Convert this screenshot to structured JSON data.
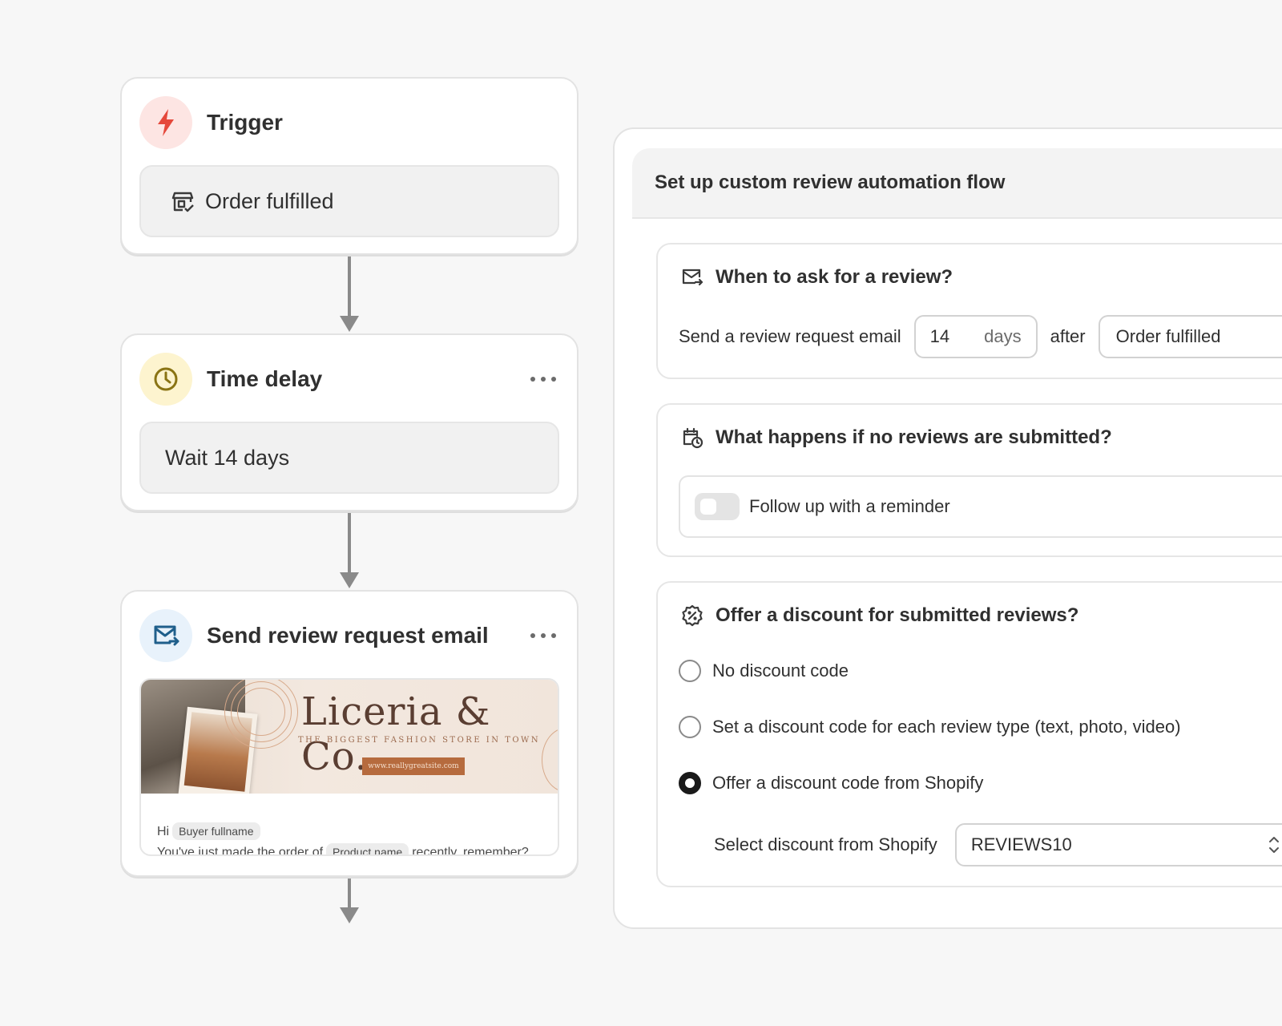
{
  "flow": {
    "trigger": {
      "title": "Trigger",
      "event": "Order fulfilled",
      "icon": "lightning-icon"
    },
    "delay": {
      "title": "Time delay",
      "text": "Wait 14 days",
      "icon": "clock-icon"
    },
    "email": {
      "title": "Send review request email",
      "icon": "mail-forward-icon",
      "brand": "Liceria & Co.",
      "tagline": "THE BIGGEST FASHION STORE IN TOWN",
      "site": "www.reallygreatsite.com",
      "greeting": "Hi",
      "buyer_chip": "Buyer fullname",
      "line_start": "You've just made the order of",
      "product_chip": "Product name",
      "line_end": "recently, remember?"
    }
  },
  "panel": {
    "title": "Set up custom review automation flow",
    "when": {
      "title": "When to ask for a review?",
      "label": "Send a review request email",
      "days_value": "14",
      "days_suffix": "days",
      "after": "after",
      "event_value": "Order fulfilled"
    },
    "no_reviews": {
      "title": "What happens if no reviews are submitted?",
      "toggle_label": "Follow up with a reminder",
      "toggle_on": false
    },
    "discount": {
      "title": "Offer a discount for submitted reviews?",
      "options": [
        {
          "label": "No discount code",
          "selected": false
        },
        {
          "label": "Set a discount code for each review type (text, photo, video)",
          "selected": false
        },
        {
          "label": "Offer a discount code from Shopify",
          "selected": true
        }
      ],
      "select_label": "Select discount from Shopify",
      "select_value": "REVIEWS10"
    }
  },
  "colors": {
    "trigger_bg": "#fde5e3",
    "trigger_icon": "#e5483b",
    "delay_bg": "#fdf4cf",
    "delay_icon": "#8a7414",
    "email_bg": "#e8f2fb",
    "email_icon": "#1f5f8b"
  }
}
